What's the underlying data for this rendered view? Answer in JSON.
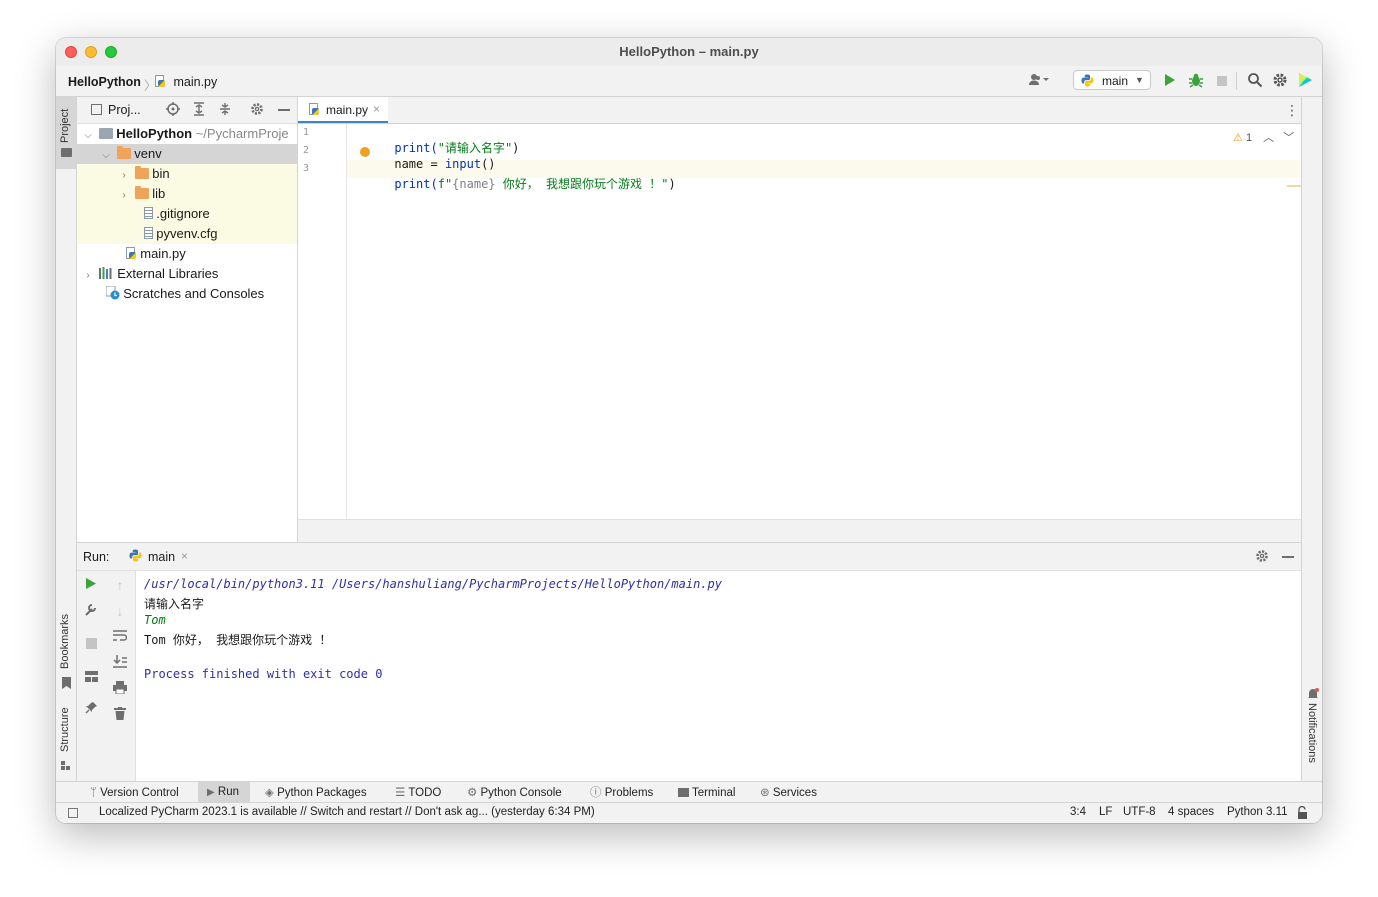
{
  "window": {
    "title": "HelloPython – main.py"
  },
  "breadcrumb": {
    "project": "HelloPython",
    "file": "main.py"
  },
  "toolbar": {
    "run_config": "main"
  },
  "sidebar_left": {
    "project_label": "Project",
    "bookmarks_label": "Bookmarks",
    "structure_label": "Structure"
  },
  "project_panel": {
    "title": "Proj...",
    "tree": [
      {
        "label": "HelloPython",
        "hint": "~/PycharmProje"
      },
      {
        "label": "venv"
      },
      {
        "label": "bin"
      },
      {
        "label": "lib"
      },
      {
        "label": ".gitignore"
      },
      {
        "label": "pyvenv.cfg"
      },
      {
        "label": "main.py"
      },
      {
        "label": "External Libraries"
      },
      {
        "label": "Scratches and Consoles"
      }
    ]
  },
  "editor": {
    "tab_label": "main.py",
    "warnings_count": "1",
    "line_numbers": [
      "1",
      "2",
      "3"
    ],
    "lines": [
      {
        "p1": "print(",
        "p2": "\"请输入名字\"",
        "p3": ")"
      },
      {
        "p1": "name",
        "p2": " = ",
        "p3": "input",
        "p4": "()"
      },
      {
        "p1": "print(",
        "p2": "f\"",
        "p3": "{name}",
        "p4": " 你好， 我想跟你玩个游戏 ！\"",
        "p5": ")"
      }
    ]
  },
  "run_panel": {
    "label": "Run:",
    "tab": "main",
    "output": [
      "/usr/local/bin/python3.11 /Users/hanshuliang/PycharmProjects/HelloPython/main.py",
      "请输入名字",
      "Tom",
      "Tom 你好， 我想跟你玩个游戏 ！",
      "",
      "Process finished with exit code 0"
    ]
  },
  "notifications_label": "Notifications",
  "tool_windows": {
    "version_control": "Version Control",
    "run": "Run",
    "python_packages": "Python Packages",
    "todo": "TODO",
    "python_console": "Python Console",
    "problems": "Problems",
    "terminal": "Terminal",
    "services": "Services"
  },
  "status_bar": {
    "message": "Localized PyCharm 2023.1 is available // Switch and restart // Don't ask ag... (yesterday 6:34 PM)",
    "position": "3:4",
    "line_sep": "LF",
    "encoding": "UTF-8",
    "indent": "4 spaces",
    "interpreter": "Python 3.11"
  },
  "colors": {
    "accent": "#4083c9",
    "run_green": "#3aa33a",
    "string_green": "#067d17",
    "keyword_blue": "#0033b3",
    "console_blue": "#2f2fa8"
  }
}
